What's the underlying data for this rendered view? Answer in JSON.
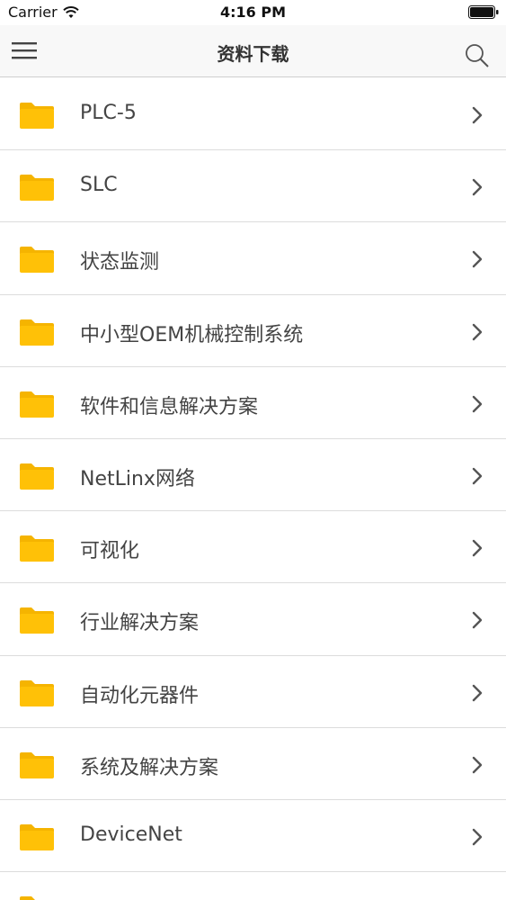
{
  "status_bar": {
    "carrier": "Carrier",
    "time": "4:16 PM"
  },
  "nav": {
    "title": "资料下载",
    "menu_icon": "hamburger-menu-icon",
    "search_icon": "search-icon"
  },
  "colors": {
    "folder": "#ffc107",
    "folder_tab": "#f5b400",
    "chevron": "#555555",
    "divider": "#dcdcdc",
    "nav_bg": "#f8f8f8"
  },
  "list": {
    "items": [
      {
        "label": "PLC-5"
      },
      {
        "label": "SLC"
      },
      {
        "label": "状态监测"
      },
      {
        "label": "中小型OEM机械控制系统"
      },
      {
        "label": "软件和信息解决方案"
      },
      {
        "label": "NetLinx网络"
      },
      {
        "label": "可视化"
      },
      {
        "label": "行业解决方案"
      },
      {
        "label": "自动化元器件"
      },
      {
        "label": "系统及解决方案"
      },
      {
        "label": "DeviceNet"
      },
      {
        "label": ""
      }
    ]
  }
}
